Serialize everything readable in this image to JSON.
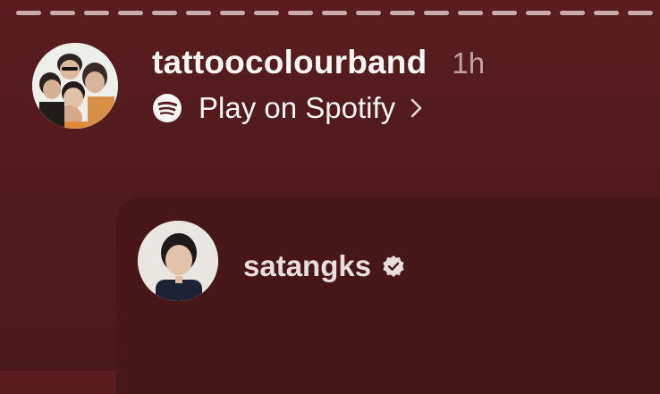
{
  "story": {
    "segment_count": 19
  },
  "header": {
    "username": "tattoocolourband",
    "time_ago": "1h",
    "spotify_label": "Play on Spotify",
    "icons": {
      "avatar": "band-avatar",
      "spotify": "spotify-icon",
      "chevron": "chevron-right-icon"
    }
  },
  "shared_post": {
    "username": "satangks",
    "icons": {
      "avatar": "user-avatar",
      "verified": "verified-badge-icon"
    }
  },
  "colors": {
    "background": "#561b1e",
    "card": "#461619",
    "text": "#fbf6f6",
    "muted_text": "#c9a9a9"
  }
}
